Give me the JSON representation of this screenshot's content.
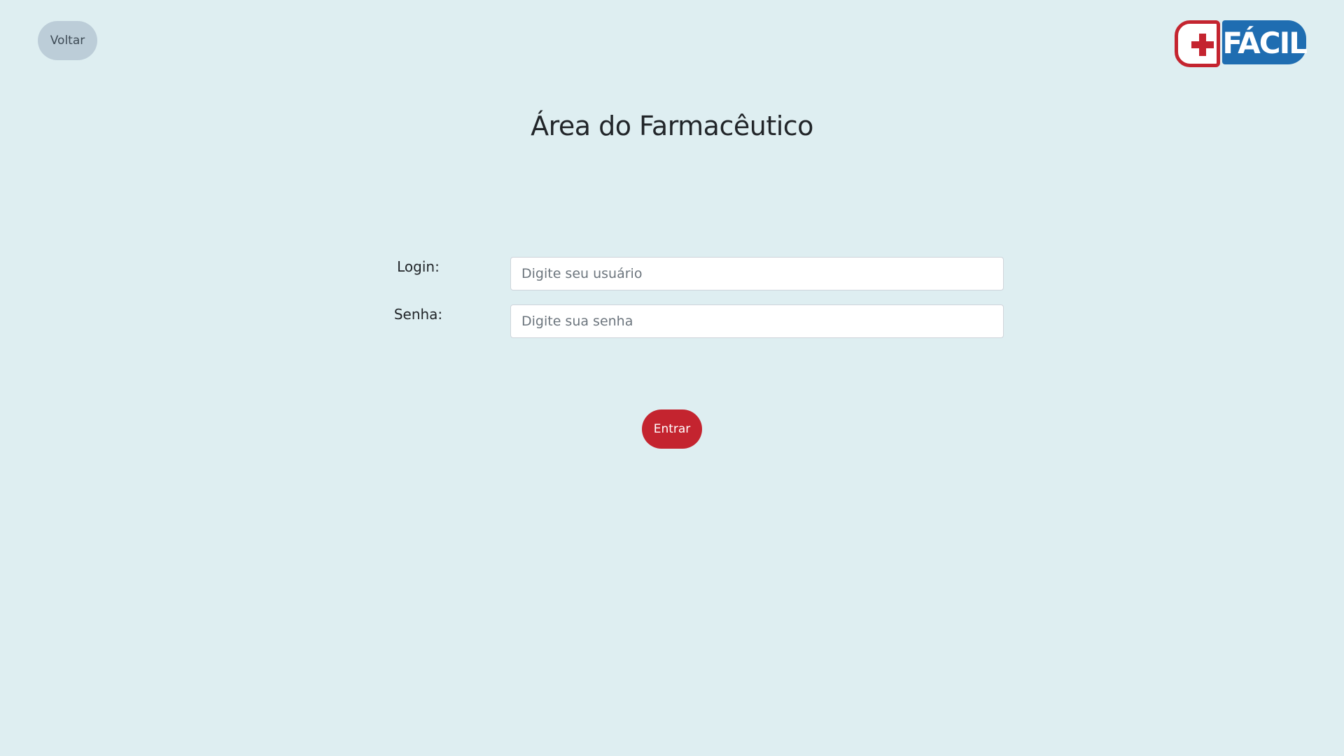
{
  "header": {
    "back_label": "Voltar",
    "logo": {
      "icon": "plus-cross-icon",
      "text": "FÁCIL",
      "colors": {
        "cross": "#c4242f",
        "word_bg": "#1f6db1"
      }
    }
  },
  "main": {
    "title": "Área do Farmacêutico",
    "login": {
      "label": "Login:",
      "placeholder": "Digite seu usuário",
      "value": ""
    },
    "password": {
      "label": "Senha:",
      "placeholder": "Digite sua senha",
      "value": ""
    },
    "submit_label": "Entrar"
  },
  "colors": {
    "background": "#deeef1",
    "back_button": "#bccdd8",
    "primary": "#c4242f"
  }
}
